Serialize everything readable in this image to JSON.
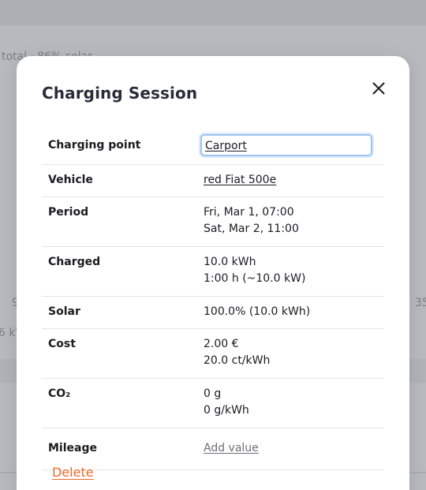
{
  "background": {
    "summary_fragment": "total · 86% solar",
    "left_fragment_1": "9",
    "left_fragment_2": "6 kV",
    "right_fragment": "35"
  },
  "modal": {
    "title": "Charging Session",
    "close_icon": "close-icon",
    "rows": {
      "charging_point": {
        "label": "Charging point",
        "value": "Carport"
      },
      "vehicle": {
        "label": "Vehicle",
        "value": "red Fiat 500e"
      },
      "period": {
        "label": "Period",
        "start": "Fri, Mar 1, 07:00",
        "end": "Sat, Mar 2, 11:00"
      },
      "charged": {
        "label": "Charged",
        "energy": "10.0 kWh",
        "duration": "1:00 h (~10.0 kW)"
      },
      "solar": {
        "label": "Solar",
        "value": "100.0% (10.0 kWh)"
      },
      "cost": {
        "label": "Cost",
        "total": "2.00 €",
        "per_kwh": "20.0 ct/kWh"
      },
      "co2": {
        "label": "CO₂",
        "total": "0 g",
        "per_kwh": "0 g/kWh"
      },
      "mileage": {
        "label": "Mileage",
        "value": "Add value"
      }
    },
    "delete_label": "Delete"
  },
  "colors": {
    "accent_delete": "#ea6a26",
    "focus_ring": "#9fc3ec",
    "overlay": "#b8b9be"
  }
}
